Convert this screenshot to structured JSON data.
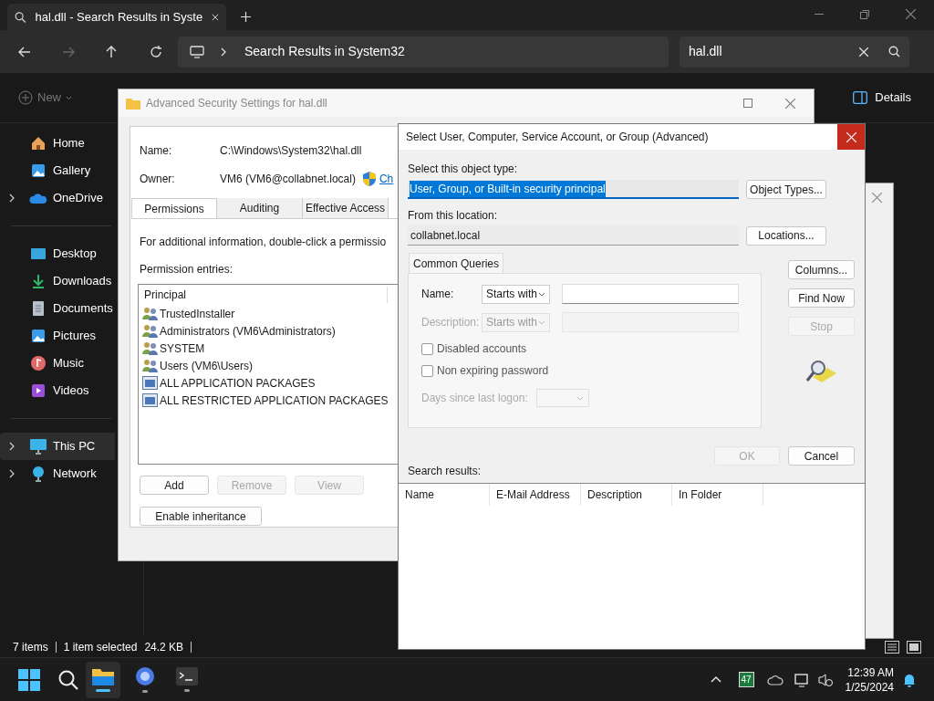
{
  "explorer": {
    "tab": {
      "title": "hal.dll - Search Results in Syste"
    },
    "address": {
      "location": "Search Results in System32"
    },
    "search": {
      "value": "hal.dll"
    },
    "toolbar": {
      "new": "New",
      "details": "Details"
    },
    "sidebar": {
      "sections": [
        {
          "items": [
            {
              "label": "Home",
              "selected": false,
              "chevron": false
            },
            {
              "label": "Gallery",
              "selected": false,
              "chevron": false
            },
            {
              "label": "OneDrive",
              "selected": false,
              "chevron": true
            }
          ]
        },
        {
          "items": [
            {
              "label": "Desktop",
              "selected": false,
              "chevron": false
            },
            {
              "label": "Downloads",
              "selected": false,
              "chevron": false
            },
            {
              "label": "Documents",
              "selected": false,
              "chevron": false
            },
            {
              "label": "Pictures",
              "selected": false,
              "chevron": false
            },
            {
              "label": "Music",
              "selected": false,
              "chevron": false
            },
            {
              "label": "Videos",
              "selected": false,
              "chevron": false
            }
          ]
        },
        {
          "items": [
            {
              "label": "This PC",
              "selected": true,
              "chevron": true
            },
            {
              "label": "Network",
              "selected": false,
              "chevron": true
            }
          ]
        }
      ]
    },
    "status_bar": {
      "count": "7 items",
      "selection": "1 item selected",
      "size": "24.2 KB"
    }
  },
  "security_window": {
    "title": "Advanced Security Settings for hal.dll",
    "name_label": "Name:",
    "name": "C:\\Windows\\System32\\hal.dll",
    "owner_label": "Owner:",
    "owner": "VM6 (VM6@collabnet.local)",
    "change_link": "Ch",
    "tabs": [
      {
        "label": "Permissions",
        "selected": true
      },
      {
        "label": "Auditing",
        "selected": false
      },
      {
        "label": "Effective Access",
        "selected": false
      }
    ],
    "info": "For additional information, double-click a permissio",
    "entries_label": "Permission entries:",
    "table": {
      "columns": [
        "Principal"
      ],
      "rows": [
        {
          "kind": "group",
          "principal": "TrustedInstaller"
        },
        {
          "kind": "group",
          "principal": "Administrators (VM6\\Administrators)"
        },
        {
          "kind": "group",
          "principal": "SYSTEM"
        },
        {
          "kind": "group",
          "principal": "Users (VM6\\Users)"
        },
        {
          "kind": "package",
          "principal": "ALL APPLICATION PACKAGES"
        },
        {
          "kind": "package",
          "principal": "ALL RESTRICTED APPLICATION PACKAGES"
        }
      ]
    },
    "buttons": [
      {
        "label": "Add",
        "disabled": false
      },
      {
        "label": "Remove",
        "disabled": true
      },
      {
        "label": "View",
        "disabled": true
      }
    ],
    "inheritance_button": "Enable inheritance"
  },
  "dialog": {
    "title": "Select User, Computer, Service Account, or Group (Advanced)",
    "object_type_label": "Select this object type:",
    "object_type": {
      "value": "User, Group, or Built-in security principal",
      "text_selected": true
    },
    "object_types_button": "Object Types...",
    "location_label": "From this location:",
    "location": "collabnet.local",
    "locations_button": "Locations...",
    "queries_tab": "Common Queries",
    "name_label": "Name:",
    "name_match": "Starts with",
    "description_label": "Description:",
    "description_match": "Starts with",
    "checkboxes": [
      {
        "label": "Disabled accounts",
        "checked": false
      },
      {
        "label": "Non expiring password",
        "checked": false
      }
    ],
    "days_label": "Days since last logon:",
    "side_buttons": [
      {
        "label": "Columns...",
        "disabled": false
      },
      {
        "label": "Find Now",
        "disabled": false
      },
      {
        "label": "Stop",
        "disabled": true
      }
    ],
    "ok": {
      "label": "OK",
      "disabled": true
    },
    "cancel": {
      "label": "Cancel",
      "disabled": false
    },
    "results_label": "Search results:",
    "results_columns": [
      "Name",
      "E-Mail Address",
      "Description",
      "In Folder"
    ]
  },
  "taskbar": {
    "apps": [
      {
        "selected": true,
        "running": true
      },
      {
        "selected": false,
        "running": true
      },
      {
        "selected": false,
        "running": true
      }
    ],
    "tray": {
      "badge": "47",
      "time": "12:39 AM",
      "date": "1/25/2024"
    }
  }
}
